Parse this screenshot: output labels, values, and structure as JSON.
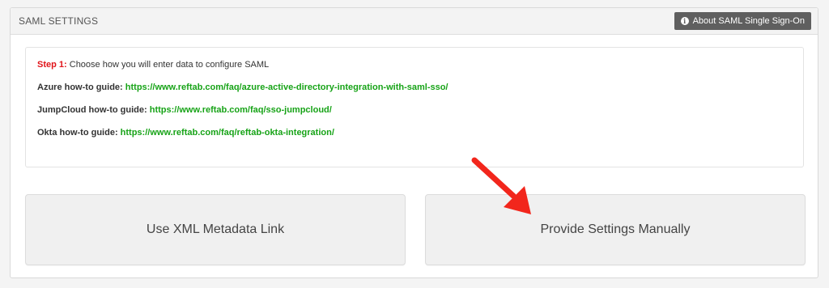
{
  "header": {
    "title": "SAML SETTINGS",
    "about_button_label": "About SAML Single Sign-On",
    "about_icon": "info-circle-icon"
  },
  "guides": {
    "step_label": "Step 1:",
    "step_text": " Choose how you will enter data to configure SAML",
    "items": [
      {
        "label": "Azure how-to guide:",
        "url": "https://www.reftab.com/faq/azure-active-directory-integration-with-saml-sso/"
      },
      {
        "label": "JumpCloud how-to guide:",
        "url": "https://www.reftab.com/faq/sso-jumpcloud/"
      },
      {
        "label": "Okta how-to guide:",
        "url": "https://www.reftab.com/faq/reftab-okta-integration/"
      }
    ]
  },
  "options": {
    "xml_label": "Use XML Metadata Link",
    "manual_label": "Provide Settings Manually"
  },
  "colors": {
    "step_red": "#e1141a",
    "link_green": "#17a317",
    "arrow_red": "#f2261c",
    "button_dark": "#5f5f5f"
  }
}
